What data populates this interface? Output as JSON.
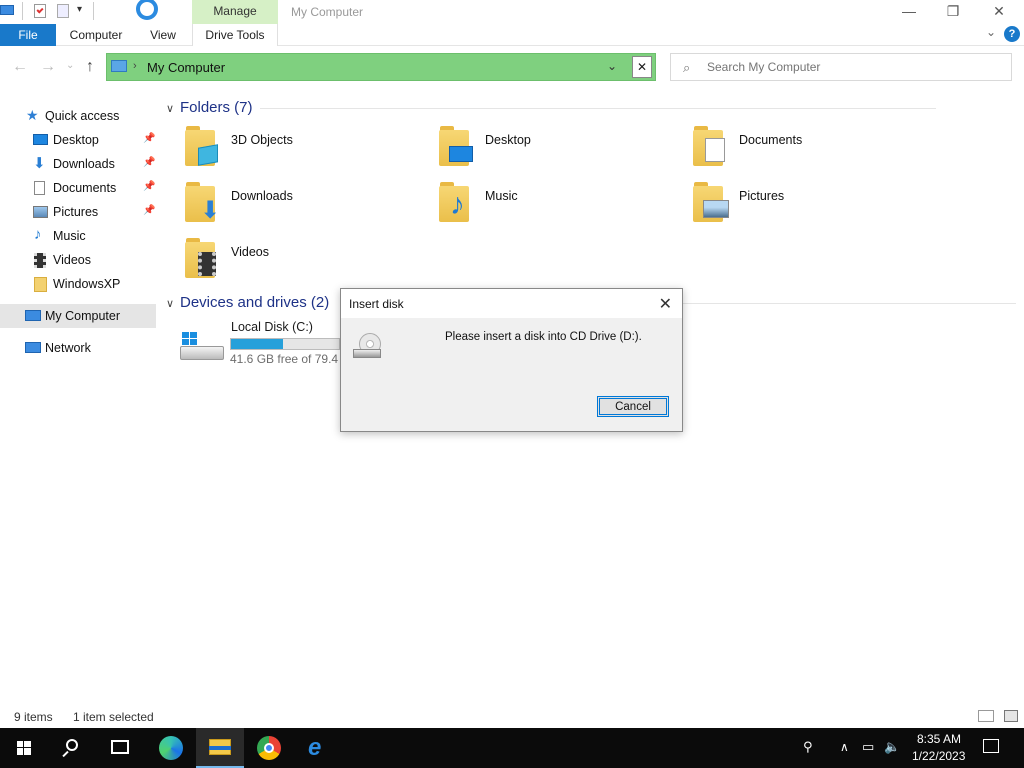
{
  "window": {
    "title": "My Computer",
    "context_tab": "Manage",
    "controls": {
      "minimize": "—",
      "maximize": "❐",
      "close": "✕"
    }
  },
  "ribbon": {
    "tabs": [
      "File",
      "Computer",
      "View",
      "Drive Tools"
    ],
    "help": "?",
    "expand": "⌄"
  },
  "address": {
    "path": "My Computer",
    "chevron": "›",
    "dropdown": "⌄",
    "clear": "✕",
    "search_placeholder": "Search My Computer"
  },
  "sidebar": {
    "items": [
      {
        "label": "Quick access",
        "icon": "star-icon"
      },
      {
        "label": "Desktop",
        "icon": "desktop-icon",
        "pinned": true
      },
      {
        "label": "Downloads",
        "icon": "download-arrow-icon",
        "pinned": true
      },
      {
        "label": "Documents",
        "icon": "document-icon",
        "pinned": true
      },
      {
        "label": "Pictures",
        "icon": "picture-icon",
        "pinned": true
      },
      {
        "label": "Music",
        "icon": "music-note-icon"
      },
      {
        "label": "Videos",
        "icon": "film-icon"
      },
      {
        "label": "WindowsXP",
        "icon": "folder-icon"
      },
      {
        "label": "My Computer",
        "icon": "computer-icon",
        "selected": true
      },
      {
        "label": "Network",
        "icon": "network-icon"
      }
    ],
    "pin_glyph": "📌"
  },
  "content": {
    "folders_header": "Folders (7)",
    "folders": [
      {
        "name": "3D Objects",
        "overlay": "cube-icon"
      },
      {
        "name": "Desktop",
        "overlay": "desktop-icon"
      },
      {
        "name": "Documents",
        "overlay": "document-icon"
      },
      {
        "name": "Downloads",
        "overlay": "download-arrow-icon"
      },
      {
        "name": "Music",
        "overlay": "music-note-icon"
      },
      {
        "name": "Pictures",
        "overlay": "picture-icon"
      },
      {
        "name": "Videos",
        "overlay": "film-icon"
      }
    ],
    "devices_header": "Devices and drives (2)",
    "drive": {
      "name": "Local Disk (C:)",
      "free_text": "41.6 GB free of 79.4 G",
      "used_fraction": 0.48
    }
  },
  "status": {
    "items_count": "9 items",
    "selection": "1 item selected"
  },
  "dialog": {
    "title": "Insert disk",
    "message": "Please insert a disk into CD Drive (D:).",
    "cancel": "Cancel",
    "close": "✕"
  },
  "taskbar": {
    "time": "8:35 AM",
    "date": "1/22/2023",
    "apps": [
      "start-icon",
      "search-icon",
      "task-view-icon",
      "edge-icon",
      "file-explorer-icon",
      "chrome-icon",
      "internet-explorer-icon"
    ]
  },
  "colors": {
    "accent": "#1979ca",
    "address_highlight": "#7fd07f",
    "manage_tab": "#d6f0c6",
    "taskbar": "#0b0b0b"
  }
}
